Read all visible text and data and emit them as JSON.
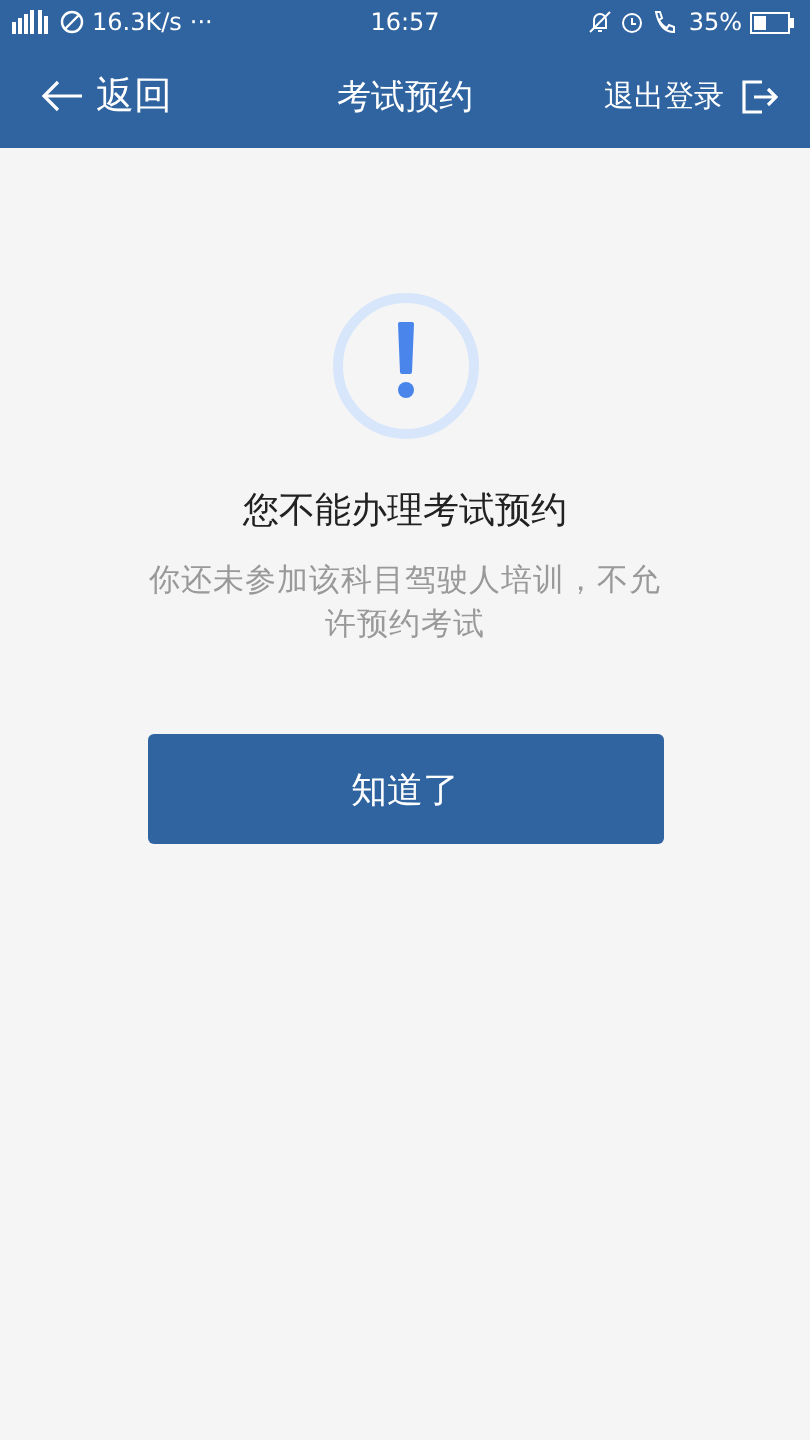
{
  "status_bar": {
    "speed": "16.3K/s",
    "more": "···",
    "time": "16:57",
    "battery": "35%"
  },
  "nav_bar": {
    "back": "返回",
    "title": "考试预约",
    "logout": "退出登录"
  },
  "notice": {
    "title": "您不能办理考试预约",
    "message": "你还未参加该科目驾驶人培训，不允许预约考试"
  },
  "buttons": [
    {
      "label": "知道了"
    }
  ]
}
